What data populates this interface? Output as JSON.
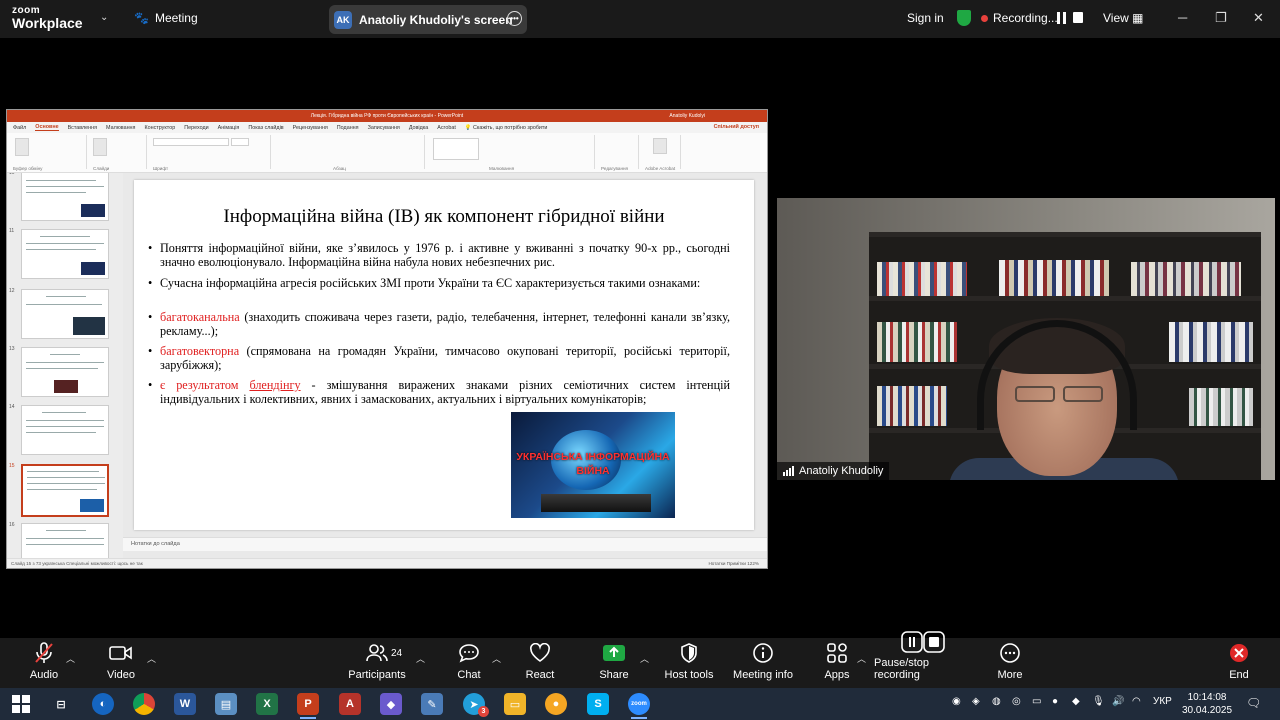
{
  "zoom": {
    "logo_line1": "zoom",
    "logo_line2": "Workplace",
    "meeting_label": "Meeting",
    "screen_initials": "AK",
    "screen_label": "Anatoliy Khudoliy's screen",
    "signin_label": "Sign in",
    "recording_label": "Recording...",
    "view_label": "View"
  },
  "powerpoint": {
    "title_bar": "Лекція. Гібридна війна РФ проти Європейських країн  -  PowerPoint",
    "user_name": "Anatoliy Kudolyi",
    "tabs": [
      "Файл",
      "Основне",
      "Вставлення",
      "Малювання",
      "Конструктор",
      "Переходи",
      "Анімація",
      "Показ слайдів",
      "Рецензування",
      "Подання",
      "Записування",
      "Довідка",
      "Acrobat"
    ],
    "active_tab": "Основне",
    "search_placeholder": "Скажіть, що потрібно зробити",
    "share_label": "Спільний доступ",
    "ribbon_groups": [
      "Буфер обміну",
      "Слайди",
      "Шрифт",
      "Абзац",
      "Малювання",
      "Редагування",
      "Adobe Acrobat"
    ],
    "thumb_numbers": [
      "10",
      "11",
      "12",
      "13",
      "14",
      "15",
      "16"
    ],
    "notes_label": "Нотатки до слайда",
    "status_left": "Слайд 15 з 73     українська     Спеціальні можливості: щось не так",
    "status_right": "Нотатки     Примітки          122%"
  },
  "slide": {
    "title": "Інформаційна війна (ІВ) як компонент гібридної війни",
    "bullet1": "Поняття інформаційної війни, яке з’явилось у 1976 р. і активне у вживанні з початку 90-х рр., сьогодні значно еволюціонувало. Інформаційна війна набула нових небезпечних рис.",
    "bullet2": "Сучасна інформаційна агресія російських ЗМІ проти України та ЄС характеризується такими ознаками:",
    "bullet3_red": "багатоканальна",
    "bullet3_rest": " (знаходить споживача через газети, радіо, телебачення, інтернет, телефонні канали зв’язку, рекламу...);",
    "bullet4_red": "багатовекторна",
    "bullet4_rest": " (спрямована на громадян України, тимчасово окуповані території, російські території, зарубіжжя);",
    "bullet5_red1": "є результатом ",
    "bullet5_red2": "блендінгу",
    "bullet5_rest": " - змішування виражених знаками різних семіотичних систем інтенцій індивідуальних і колективних, явних і замаскованих, актуальних і віртуальних комунікаторів;",
    "image_text": "УКРАЇНСЬКА ІНФОРМАЦІЙНА ВІЙНА"
  },
  "camera": {
    "participant_name": "Anatoliy Khudoliy"
  },
  "toolbar": {
    "audio": "Audio",
    "video": "Video",
    "participants": "Participants",
    "participants_count": "24",
    "chat": "Chat",
    "react": "React",
    "share": "Share",
    "host_tools": "Host tools",
    "meeting_info": "Meeting info",
    "apps": "Apps",
    "pause_stop": "Pause/stop recording",
    "more": "More",
    "end": "End"
  },
  "taskbar": {
    "chrome_badge": "3",
    "zoom_label": "zoom",
    "lang": "УКР",
    "time": "10:14:08",
    "date": "30.04.2025"
  },
  "colors": {
    "ppt_accent": "#c43e1c",
    "slide_highlight": "#e02020",
    "record_dot": "#e8413c",
    "share_green": "#1fa843"
  }
}
